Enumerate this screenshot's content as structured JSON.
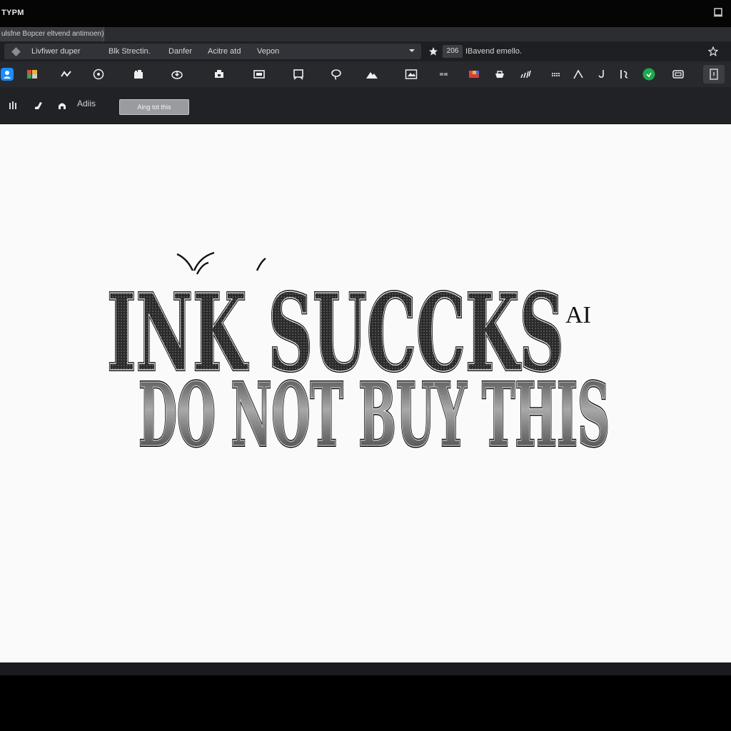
{
  "window": {
    "title": "TYPM"
  },
  "tab": {
    "label": "ulsfne Bopcer eltvend antimoen)"
  },
  "menu": {
    "items": [
      "Livfiwer duper",
      "Blk Strectin.",
      "Danfer",
      "Acitre atd",
      "Vepon"
    ],
    "extra": "Vepon • a ▾"
  },
  "document": {
    "zoom": "206",
    "name": "IBavend emello."
  },
  "subbar": {
    "label": "Adiis",
    "field_value": "Aing tot this"
  },
  "artwork": {
    "line1": "INK SUCCKS",
    "suffix": "AI",
    "line2": "DO NOT BUY THIS"
  },
  "colors": {
    "accent_blue": "#1a8cff",
    "accent_green": "#1fa84f",
    "canvas": "#fafafa"
  },
  "icons": [
    "user-icon",
    "palette-icon",
    "wave-icon",
    "target-icon",
    "layers-icon",
    "download-icon",
    "crop-icon",
    "frame-icon",
    "select-icon",
    "lasso-icon",
    "mountain-icon",
    "image-icon",
    "stamp-icon",
    "color-swatch-icon",
    "bucket-icon",
    "signal-icon",
    "grid-icon",
    "line-icon",
    "hook-icon",
    "history-icon",
    "share-icon",
    "window-icon",
    "panel-icon"
  ]
}
